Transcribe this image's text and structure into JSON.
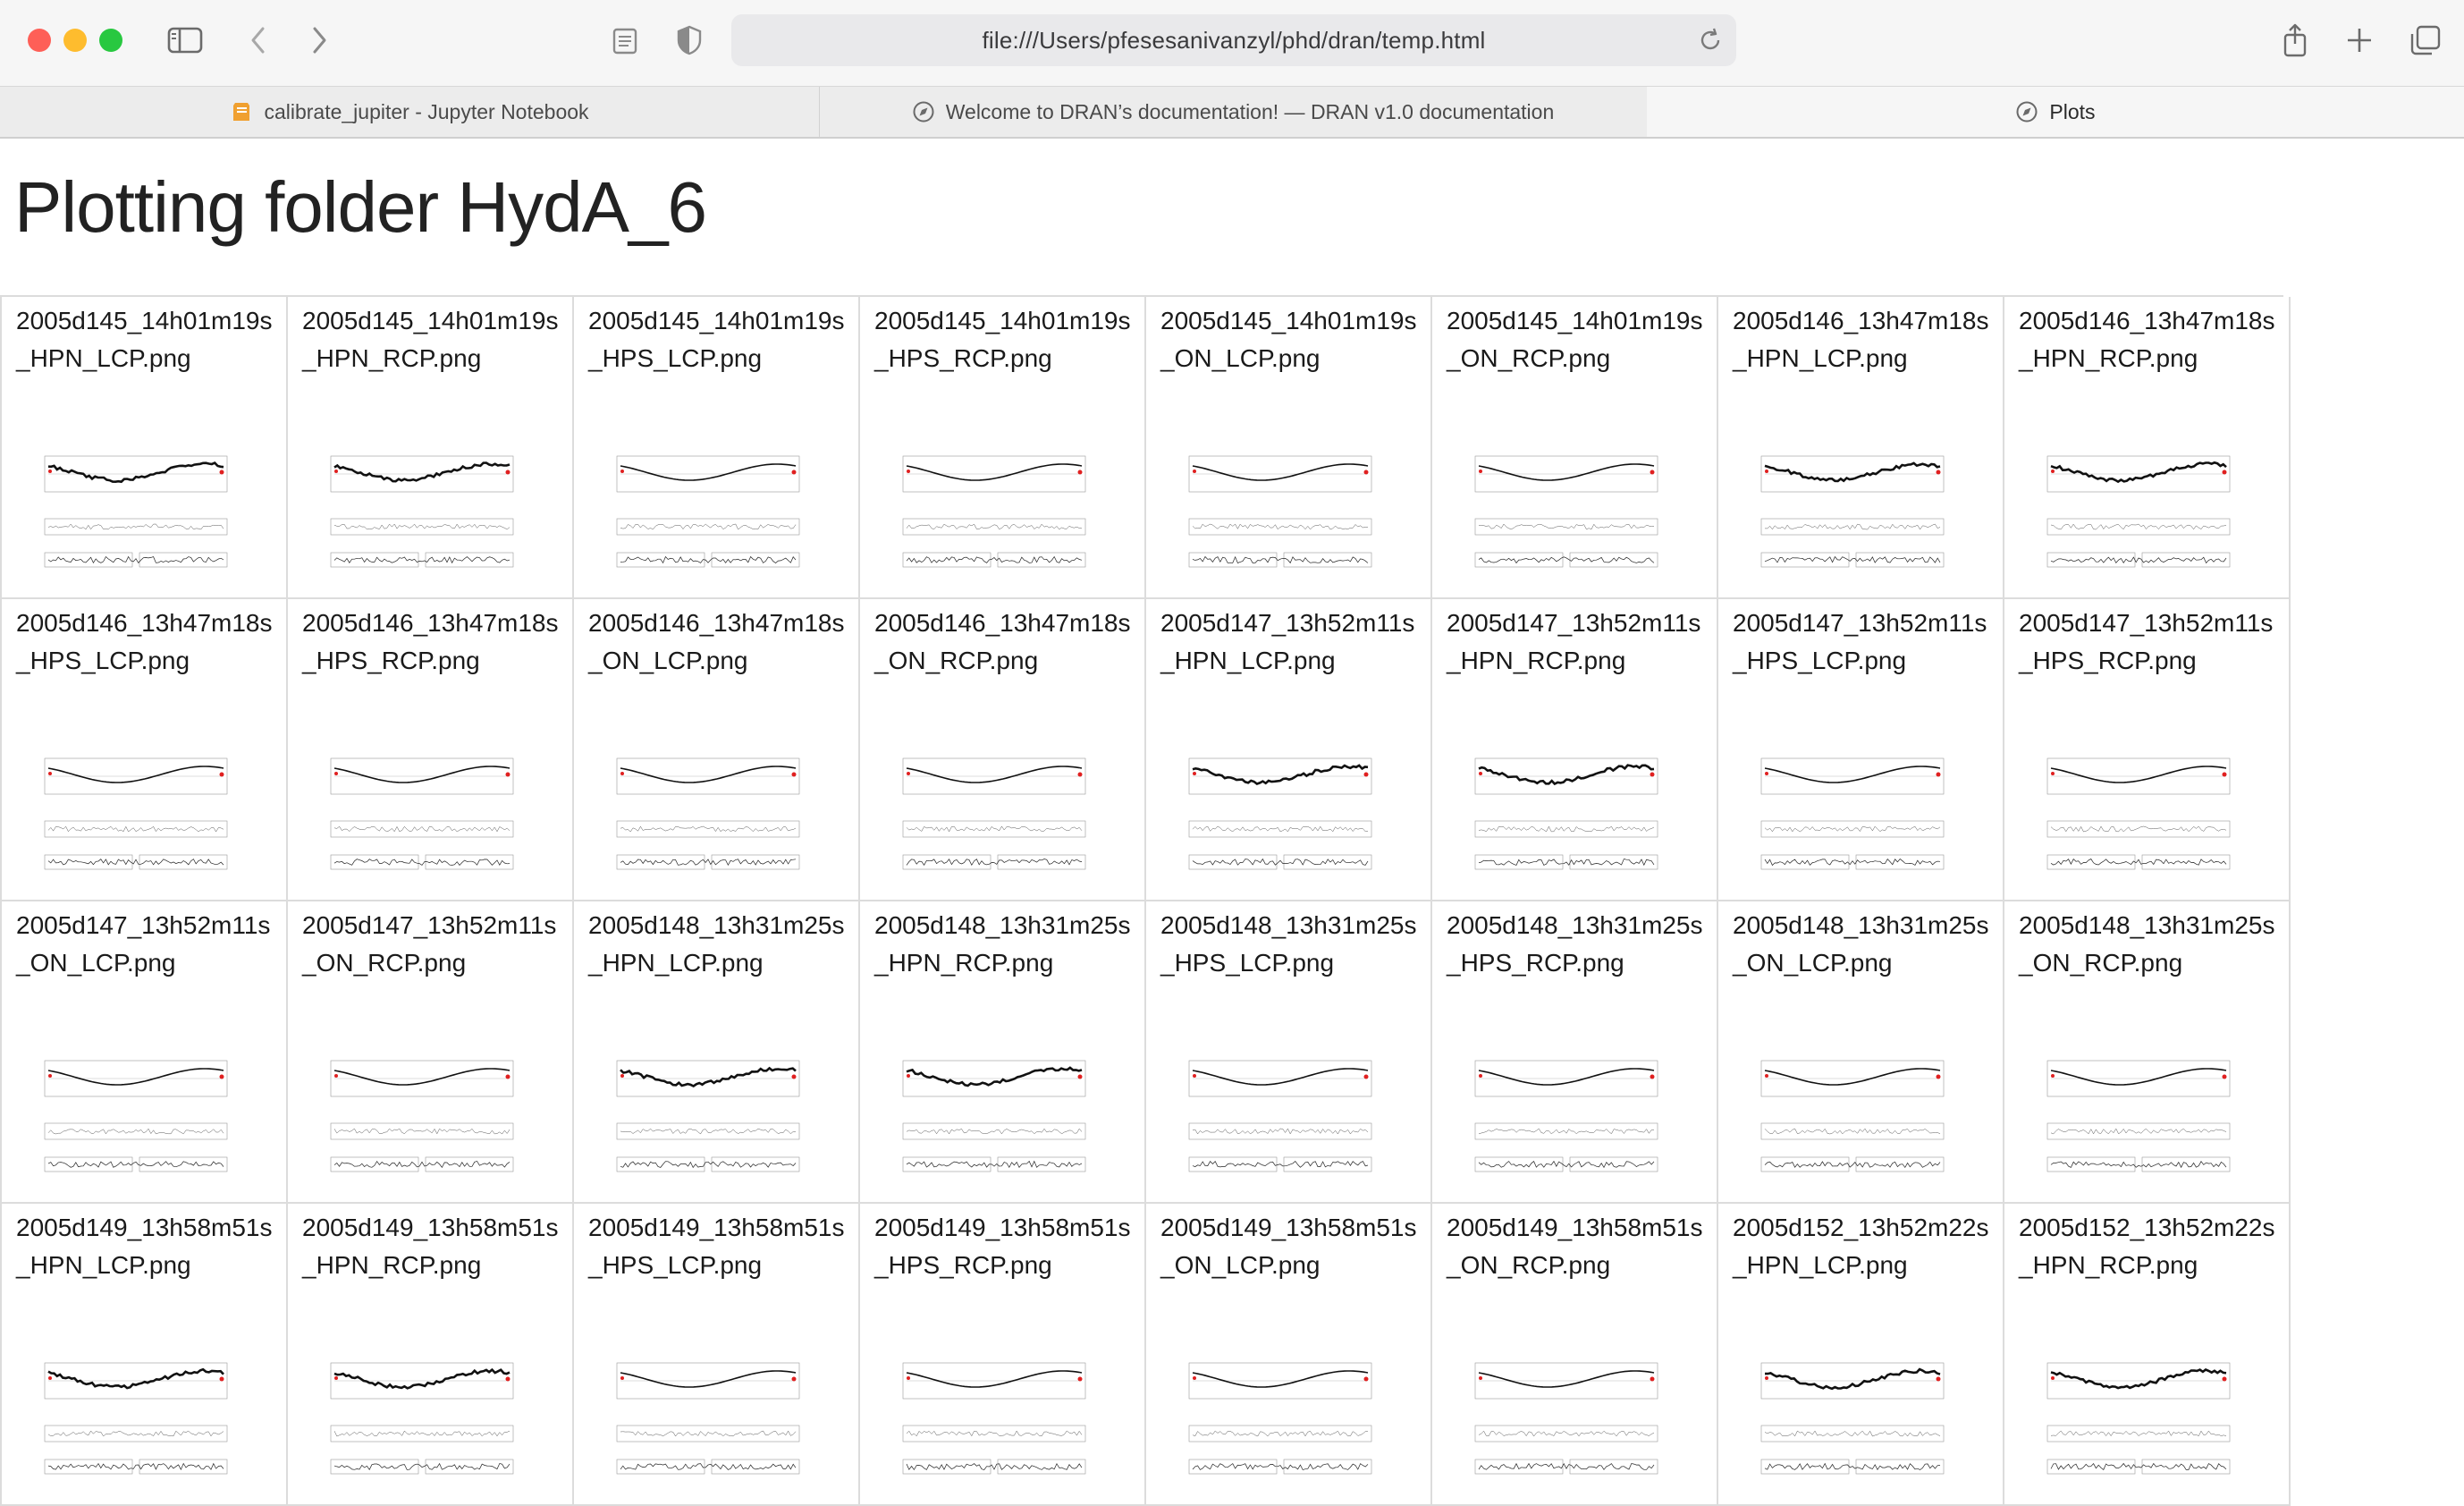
{
  "browser": {
    "url": "file:///Users/pfesesanivanzyl/phd/dran/temp.html",
    "tabs": [
      {
        "label": "calibrate_jupiter - Jupyter Notebook",
        "icon": "jupyter-icon"
      },
      {
        "label": "Welcome to DRAN’s documentation! — DRAN v1.0 documentation",
        "icon": "compass-icon"
      },
      {
        "label": "Plots",
        "icon": "compass-icon"
      }
    ],
    "colors": {
      "close": "#fe5f57",
      "minimize": "#febc2e",
      "maximize": "#28c840",
      "plot_line": "#111111",
      "plot_highlight": "#e02020"
    }
  },
  "page": {
    "title": "Plotting folder HydA_6",
    "files": [
      {
        "name": "2005d145_14h01m19s_HPN_LCP.png",
        "variant": "noisy"
      },
      {
        "name": "2005d145_14h01m19s_HPN_RCP.png",
        "variant": "noisy"
      },
      {
        "name": "2005d145_14h01m19s_HPS_LCP.png",
        "variant": "smooth"
      },
      {
        "name": "2005d145_14h01m19s_HPS_RCP.png",
        "variant": "smooth"
      },
      {
        "name": "2005d145_14h01m19s_ON_LCP.png",
        "variant": "smooth"
      },
      {
        "name": "2005d145_14h01m19s_ON_RCP.png",
        "variant": "smooth"
      },
      {
        "name": "2005d146_13h47m18s_HPN_LCP.png",
        "variant": "noisy"
      },
      {
        "name": "2005d146_13h47m18s_HPN_RCP.png",
        "variant": "noisy"
      },
      {
        "name": "2005d146_13h47m18s_HPS_LCP.png",
        "variant": "smooth"
      },
      {
        "name": "2005d146_13h47m18s_HPS_RCP.png",
        "variant": "smooth"
      },
      {
        "name": "2005d146_13h47m18s_ON_LCP.png",
        "variant": "smooth"
      },
      {
        "name": "2005d146_13h47m18s_ON_RCP.png",
        "variant": "smooth"
      },
      {
        "name": "2005d147_13h52m11s_HPN_LCP.png",
        "variant": "noisy"
      },
      {
        "name": "2005d147_13h52m11s_HPN_RCP.png",
        "variant": "noisy"
      },
      {
        "name": "2005d147_13h52m11s_HPS_LCP.png",
        "variant": "smooth"
      },
      {
        "name": "2005d147_13h52m11s_HPS_RCP.png",
        "variant": "smooth"
      },
      {
        "name": "2005d147_13h52m11s_ON_LCP.png",
        "variant": "smooth"
      },
      {
        "name": "2005d147_13h52m11s_ON_RCP.png",
        "variant": "smooth"
      },
      {
        "name": "2005d148_13h31m25s_HPN_LCP.png",
        "variant": "noisy"
      },
      {
        "name": "2005d148_13h31m25s_HPN_RCP.png",
        "variant": "noisy"
      },
      {
        "name": "2005d148_13h31m25s_HPS_LCP.png",
        "variant": "smooth"
      },
      {
        "name": "2005d148_13h31m25s_HPS_RCP.png",
        "variant": "smooth"
      },
      {
        "name": "2005d148_13h31m25s_ON_LCP.png",
        "variant": "smooth"
      },
      {
        "name": "2005d148_13h31m25s_ON_RCP.png",
        "variant": "smooth"
      },
      {
        "name": "2005d149_13h58m51s_HPN_LCP.png",
        "variant": "noisy"
      },
      {
        "name": "2005d149_13h58m51s_HPN_RCP.png",
        "variant": "noisy"
      },
      {
        "name": "2005d149_13h58m51s_HPS_LCP.png",
        "variant": "smooth"
      },
      {
        "name": "2005d149_13h58m51s_HPS_RCP.png",
        "variant": "smooth"
      },
      {
        "name": "2005d149_13h58m51s_ON_LCP.png",
        "variant": "smooth"
      },
      {
        "name": "2005d149_13h58m51s_ON_RCP.png",
        "variant": "smooth"
      },
      {
        "name": "2005d152_13h52m22s_HPN_LCP.png",
        "variant": "noisy"
      },
      {
        "name": "2005d152_13h52m22s_HPN_RCP.png",
        "variant": "noisy"
      }
    ]
  }
}
